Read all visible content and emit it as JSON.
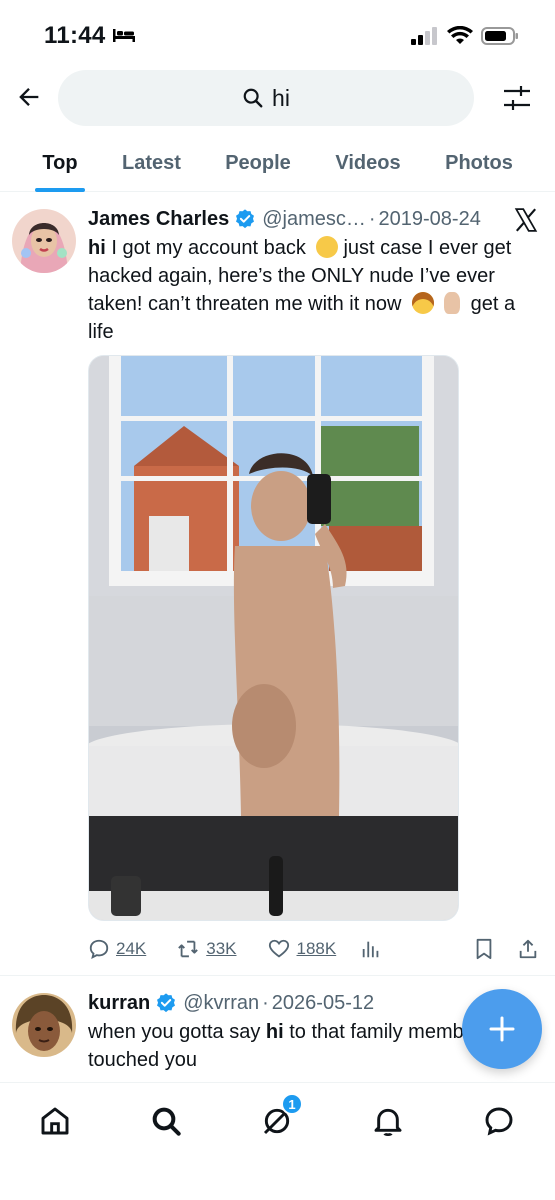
{
  "status_bar": {
    "time": "11:44"
  },
  "search": {
    "query": "hi"
  },
  "tabs": [
    {
      "label": "Top",
      "active": true
    },
    {
      "label": "Latest"
    },
    {
      "label": "People"
    },
    {
      "label": "Videos"
    },
    {
      "label": "Photos"
    }
  ],
  "tweets": [
    {
      "name": "James Charles",
      "handle": "@jamesc…",
      "date": "2019-08-24",
      "text_keyword": "hi",
      "text_line1": " I got my account back",
      "text_line1b": "just case I ever get hacked again, here’s the ONLY nude I’ve ever taken! can’t threaten me with it now",
      "text_end": "get a life",
      "replies": "24K",
      "retweets": "33K",
      "likes": "188K"
    },
    {
      "name": "kurran",
      "handle": "@kvrran",
      "date": "2026-05-12",
      "text_before": "when you gotta say ",
      "text_keyword": "hi",
      "text_after": " to that family member who touched you"
    }
  ],
  "nav": {
    "messages_badge": "1"
  },
  "colors": {
    "accent": "#1d9bf0",
    "fab": "#4c9ded",
    "text": "#0f1419",
    "muted": "#536471",
    "search_bg": "#eff3f4"
  }
}
